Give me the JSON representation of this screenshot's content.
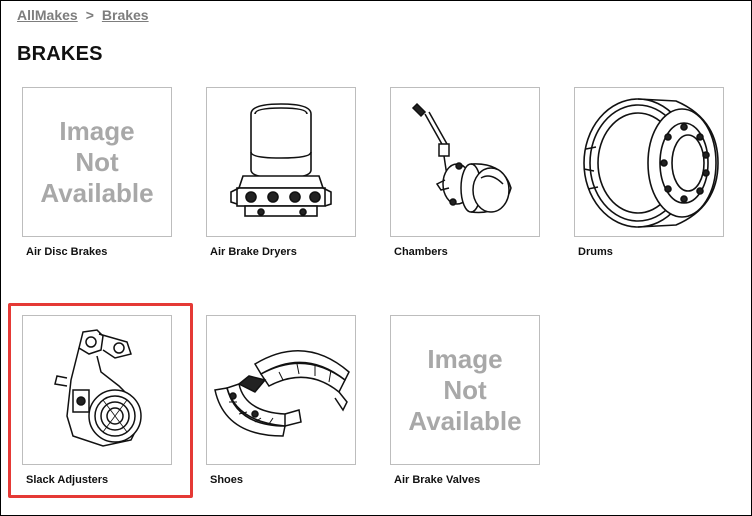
{
  "breadcrumb": {
    "items": [
      "AllMakes",
      "Brakes"
    ],
    "separator": ">"
  },
  "page_title": "BRAKES",
  "image_placeholder": {
    "lines": [
      "Image",
      "Not",
      "Available"
    ]
  },
  "products": [
    {
      "label": "Air Disc Brakes",
      "image": "image-not-available"
    },
    {
      "label": "Air Brake Dryers",
      "image": "air-dryer-icon"
    },
    {
      "label": "Chambers",
      "image": "brake-chamber-icon"
    },
    {
      "label": "Drums",
      "image": "brake-drum-icon"
    },
    {
      "label": "Slack Adjusters",
      "image": "slack-adjuster-icon"
    },
    {
      "label": "Shoes",
      "image": "brake-shoe-icon"
    },
    {
      "label": "Air Brake Valves",
      "image": "image-not-available"
    }
  ],
  "highlight": {
    "target": "Slack Adjusters",
    "color": "#e53935"
  }
}
